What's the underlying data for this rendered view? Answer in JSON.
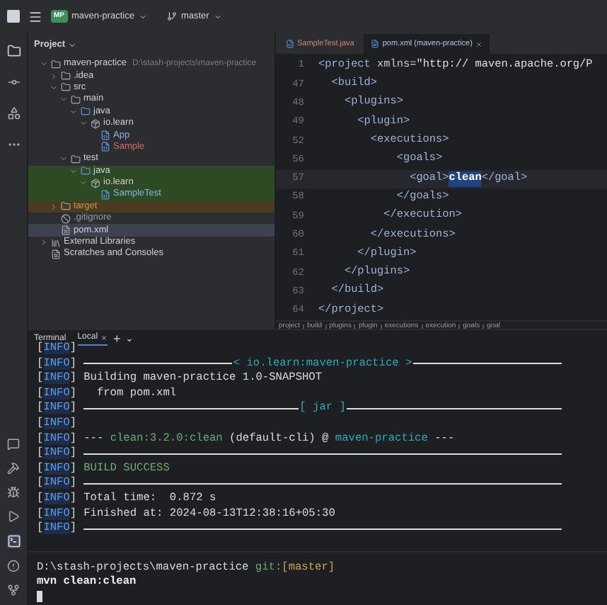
{
  "toolbar": {
    "project": {
      "badge": "MP",
      "name": "maven-practice"
    },
    "branch": "master"
  },
  "project_panel": {
    "title": "Project",
    "tree": [
      {
        "label": "maven-practice",
        "note": "D:\\stash-projects\\maven-practice",
        "kind": "module",
        "expanded": true,
        "selected": false,
        "children": [
          {
            "label": ".idea",
            "kind": "folder",
            "expanded": false,
            "selected": false
          },
          {
            "label": "src",
            "kind": "folder",
            "expanded": true,
            "selected": false,
            "children": [
              {
                "label": "main",
                "kind": "folder",
                "expanded": true,
                "selected": false,
                "children": [
                  {
                    "label": "java",
                    "kind": "source",
                    "expanded": true,
                    "selected": false,
                    "children": [
                      {
                        "label": "io.learn",
                        "kind": "package",
                        "expanded": true,
                        "selected": false,
                        "children": [
                          {
                            "label": "App",
                            "kind": "class",
                            "selected": false,
                            "color": "#8fb2e0"
                          },
                          {
                            "label": "Sample",
                            "kind": "class",
                            "selected": false,
                            "color": "#d9665f"
                          }
                        ]
                      }
                    ]
                  }
                ]
              },
              {
                "label": "test",
                "kind": "folder",
                "expanded": true,
                "selected": false,
                "children": [
                  {
                    "label": "java",
                    "kind": "test-source",
                    "expanded": true,
                    "selected": false,
                    "children": [
                      {
                        "label": "io.learn",
                        "kind": "test-package",
                        "expanded": true,
                        "selected": false,
                        "children": [
                          {
                            "label": "SampleTest",
                            "kind": "test-class",
                            "selected": false,
                            "color": "#8fb2e0"
                          }
                        ]
                      }
                    ]
                  }
                ]
              }
            ]
          },
          {
            "label": "target",
            "kind": "excluded",
            "expanded": false,
            "selected": false,
            "color": "#c99a4a"
          },
          {
            "label": ".gitignore",
            "kind": "ignore",
            "selected": false,
            "color": "#9a9a9a"
          },
          {
            "label": "pom.xml",
            "kind": "xml",
            "selected": true
          }
        ]
      },
      {
        "label": "External Libraries",
        "kind": "library",
        "expanded": false,
        "selected": false
      },
      {
        "label": "Scratches and Consoles",
        "kind": "scratch",
        "selected": false
      }
    ]
  },
  "editor": {
    "tabs": [
      {
        "label": "SampleTest.java",
        "kind": "class",
        "selected": false,
        "closable": false
      },
      {
        "label": "pom.xml (maven-practice)",
        "kind": "xml",
        "selected": true,
        "closable": true
      }
    ],
    "lines": [
      {
        "number": "1",
        "current": false,
        "parts": [
          {
            "text": "<project ",
            "kind": "tag"
          },
          {
            "text": "xmlns=",
            "kind": "attr"
          },
          {
            "text": "\"http:// maven.apache.org/P",
            "kind": "value"
          }
        ]
      },
      {
        "number": "47",
        "current": false,
        "parts": [
          {
            "text": "  <build>",
            "kind": "tag"
          }
        ]
      },
      {
        "number": "48",
        "current": false,
        "parts": [
          {
            "text": "    <plugins>",
            "kind": "tag"
          }
        ]
      },
      {
        "number": "49",
        "current": false,
        "parts": [
          {
            "text": "      <plugin>",
            "kind": "tag"
          }
        ]
      },
      {
        "number": "52",
        "current": false,
        "parts": [
          {
            "text": "        <executions>",
            "kind": "tag"
          }
        ]
      },
      {
        "number": "56",
        "current": false,
        "parts": [
          {
            "text": "            <goals>",
            "kind": "tag"
          }
        ]
      },
      {
        "number": "57",
        "current": true,
        "parts": [
          {
            "text": "              <goal>",
            "kind": "tag"
          },
          {
            "text": "clean",
            "kind": "selected"
          },
          {
            "text": "</goal>",
            "kind": "tag"
          }
        ]
      },
      {
        "number": "58",
        "current": false,
        "parts": [
          {
            "text": "            </goals>",
            "kind": "tag"
          }
        ]
      },
      {
        "number": "59",
        "current": false,
        "parts": [
          {
            "text": "          </execution>",
            "kind": "tag"
          }
        ]
      },
      {
        "number": "60",
        "current": false,
        "parts": [
          {
            "text": "        </executions>",
            "kind": "tag"
          }
        ]
      },
      {
        "number": "61",
        "current": false,
        "parts": [
          {
            "text": "      </plugin>",
            "kind": "tag"
          }
        ]
      },
      {
        "number": "62",
        "current": false,
        "parts": [
          {
            "text": "    </plugins>",
            "kind": "tag"
          }
        ]
      },
      {
        "number": "63",
        "current": false,
        "parts": [
          {
            "text": "  </build>",
            "kind": "tag"
          }
        ]
      },
      {
        "number": "64",
        "current": false,
        "parts": [
          {
            "text": "</project>",
            "kind": "tag"
          }
        ]
      }
    ],
    "breadcrumbs": [
      "project",
      "build",
      "plugins",
      "plugin",
      "executions",
      "execution",
      "goals",
      "goal"
    ]
  },
  "terminal": {
    "title": "Terminal",
    "tabs": [
      {
        "label": "Local",
        "selected": true
      }
    ],
    "add": "+",
    "menu": "⌄",
    "lines": [
      {
        "tag": "[INFO]",
        "kind": "blank"
      },
      {
        "tag": "[INFO]",
        "kind": "rule",
        "label": "< io.learn:maven-practice >"
      },
      {
        "tag": "[INFO]",
        "kind": "text",
        "parts": [
          {
            "text": "Building maven-practice 1.0-SNAPSHOT"
          }
        ]
      },
      {
        "tag": "[INFO]",
        "kind": "text",
        "parts": [
          {
            "text": "  from pom.xml"
          }
        ]
      },
      {
        "tag": "[INFO]",
        "kind": "rule",
        "label": "[ jar ]"
      },
      {
        "tag": "[INFO]",
        "kind": "blank"
      },
      {
        "tag": "[INFO]",
        "kind": "text",
        "parts": [
          {
            "text": "--- "
          },
          {
            "text": "clean:3.2.0:clean",
            "color": "#6aab73"
          },
          {
            "text": " (default-cli) @ "
          },
          {
            "text": "maven-practice",
            "color": "#2aacb8"
          },
          {
            "text": " ---"
          }
        ]
      },
      {
        "tag": "[INFO]",
        "kind": "rule"
      },
      {
        "tag": "[INFO]",
        "kind": "text",
        "parts": [
          {
            "text": "BUILD SUCCESS",
            "color": "#6aab73"
          }
        ]
      },
      {
        "tag": "[INFO]",
        "kind": "rule"
      },
      {
        "tag": "[INFO]",
        "kind": "text",
        "parts": [
          {
            "text": "Total time:  0.872 s"
          }
        ]
      },
      {
        "tag": "[INFO]",
        "kind": "text",
        "parts": [
          {
            "text": "Finished at: 2024-08-13T12:38:16+05:30"
          }
        ]
      },
      {
        "tag": "[INFO]",
        "kind": "rule"
      }
    ],
    "prompt": {
      "path": "D:\\stash-projects\\maven-practice",
      "git": "git:",
      "branch": "[master]"
    },
    "command": "mvn clean:clean"
  }
}
